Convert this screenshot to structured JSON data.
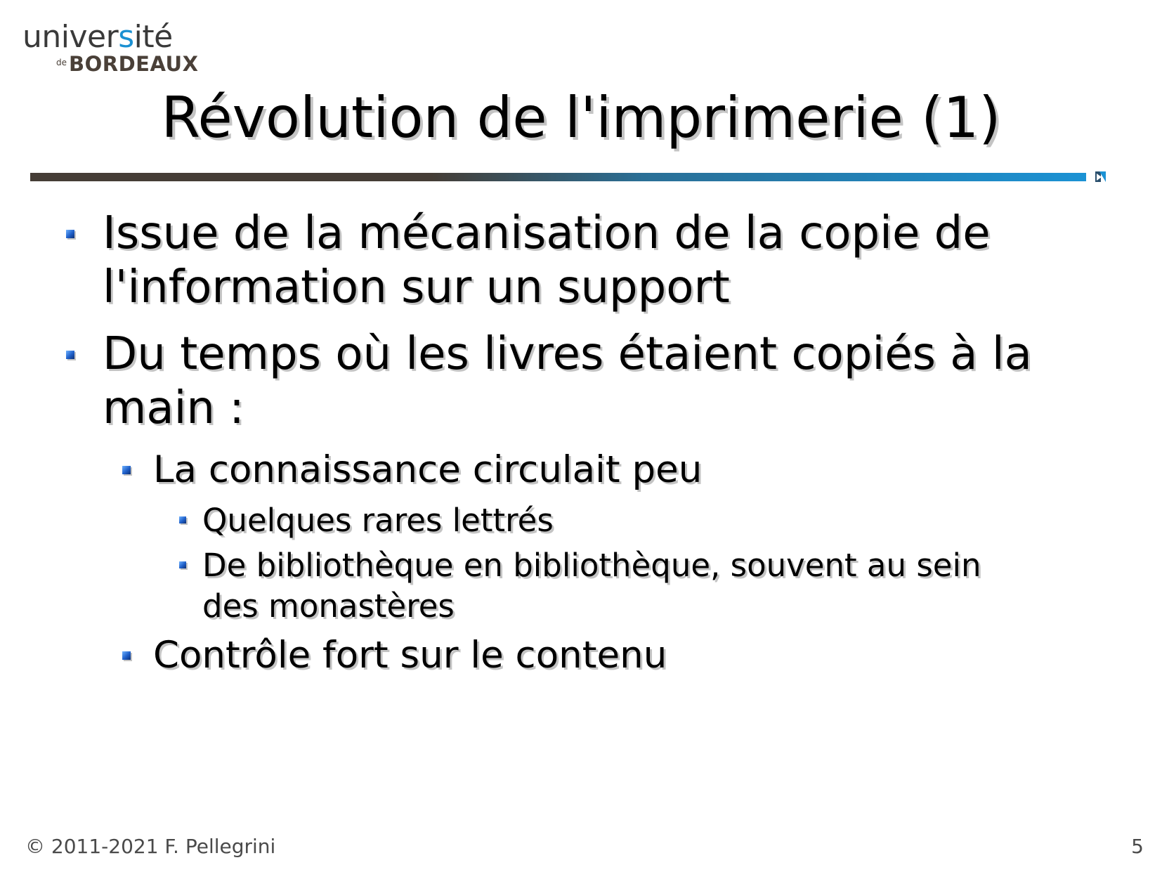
{
  "header": {
    "logo_line1_a": "univer",
    "logo_line1_b": "s",
    "logo_line1_c": "ité",
    "logo_de": "de",
    "logo_line2": "BORDEAUX",
    "accent_color": "#1a90d2"
  },
  "slide": {
    "title": "Révolution de l'imprimerie (1)",
    "bullets": [
      {
        "level": 1,
        "lines": [
          "Issue de la mécanisation de la copie de",
          "l'information sur un support"
        ]
      },
      {
        "level": 1,
        "lines": [
          "Du temps où les livres étaient copiés à la",
          "main :"
        ]
      },
      {
        "level": 2,
        "lines": [
          "La connaissance circulait peu"
        ]
      },
      {
        "level": 3,
        "lines": [
          "Quelques rares lettrés"
        ]
      },
      {
        "level": 3,
        "lines": [
          "De bibliothèque en bibliothèque, souvent au sein",
          "des monastères"
        ]
      },
      {
        "level": 2,
        "lines": [
          "Contrôle fort sur le contenu"
        ]
      }
    ]
  },
  "footer": {
    "copyright": "© 2011-2021 F. Pellegrini",
    "page_number": "5"
  }
}
